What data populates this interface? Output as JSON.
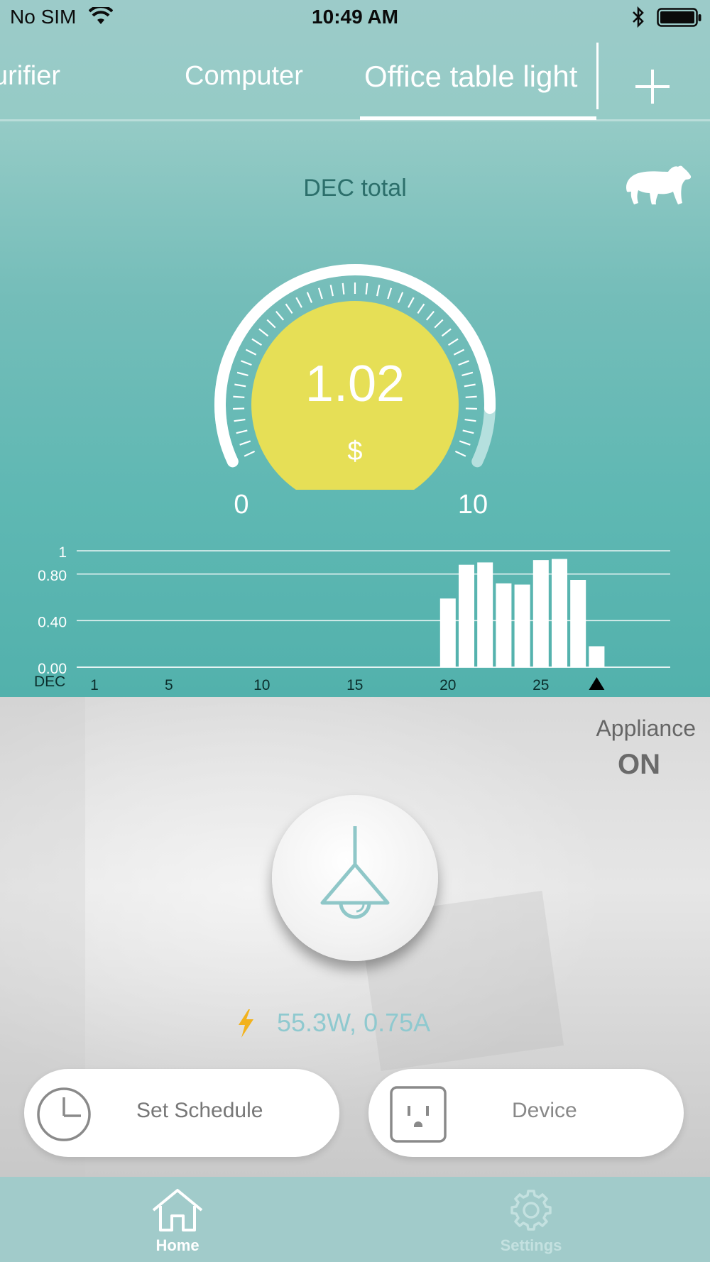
{
  "status_bar": {
    "carrier": "No SIM",
    "time": "10:49 AM"
  },
  "tabs": {
    "items": [
      {
        "label": "urifier"
      },
      {
        "label": "Computer"
      },
      {
        "label": "Office table light",
        "selected": true
      }
    ],
    "add_icon": "plus-icon"
  },
  "summary": {
    "title": "DEC total",
    "mascot_icon": "bear-icon"
  },
  "gauge": {
    "value": "1.02",
    "unit": "$",
    "min": "0",
    "max": "10",
    "fraction": 0.102
  },
  "chart_data": {
    "type": "bar",
    "xlabel": "DEC",
    "x_ticks": [
      "1",
      "5",
      "10",
      "15",
      "20",
      "25"
    ],
    "y_ticks": [
      "1",
      "0.80",
      "0.40",
      "0.00"
    ],
    "ylim": [
      0,
      1
    ],
    "categories": [
      20,
      21,
      22,
      23,
      24,
      25,
      26,
      27,
      28
    ],
    "values": [
      0.59,
      0.88,
      0.9,
      0.72,
      0.71,
      0.92,
      0.93,
      0.75,
      0.18
    ],
    "current_day_marker": 28,
    "grid": true,
    "color": "#ffffff"
  },
  "appliance": {
    "label": "Appliance",
    "state": "ON"
  },
  "device": {
    "icon": "lamp-icon",
    "power_reading": "55.3W, 0.75A",
    "power_icon": "bolt-icon"
  },
  "actions": {
    "schedule_label": "Set Schedule",
    "schedule_icon": "clock-icon",
    "device_label": "Device",
    "device_icon": "outlet-icon"
  },
  "tab_bar": {
    "home_label": "Home",
    "settings_label": "Settings",
    "active": "Home"
  },
  "colors": {
    "accent": "#5fb8b3",
    "gauge_fill": "#e6df56",
    "power_text": "#8fc9cf",
    "bolt": "#f2b21d"
  }
}
